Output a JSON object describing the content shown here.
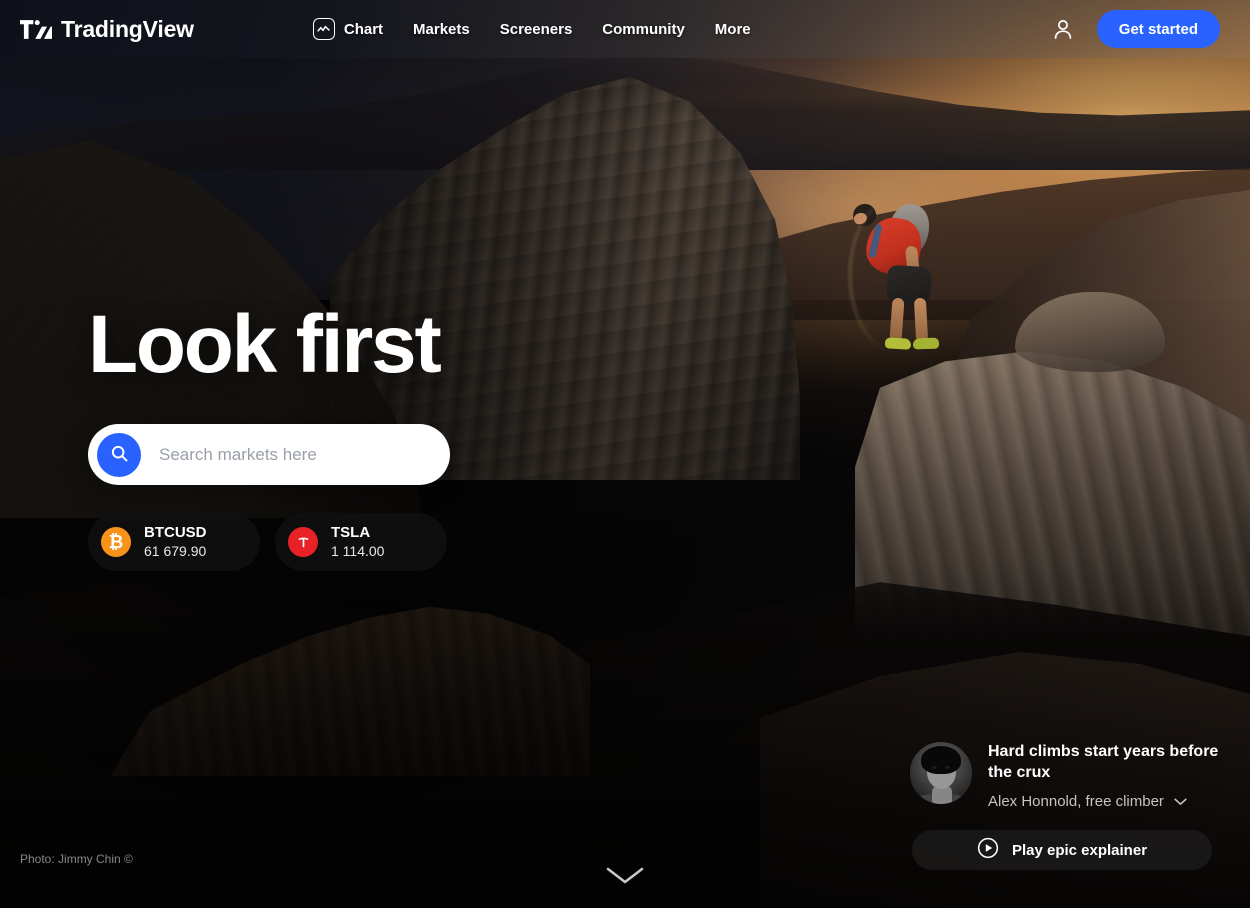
{
  "header": {
    "brand": "TradingView",
    "brand_logo_icon": "tradingview-logo-icon",
    "nav": [
      {
        "label": "Chart",
        "icon": "chart-icon"
      },
      {
        "label": "Markets",
        "icon": ""
      },
      {
        "label": "Screeners",
        "icon": ""
      },
      {
        "label": "Community",
        "icon": ""
      },
      {
        "label": "More",
        "icon": ""
      }
    ],
    "user_icon": "user-icon",
    "cta_label": "Get started",
    "cta_color": "#2962ff"
  },
  "hero": {
    "headline": "Look first",
    "search": {
      "placeholder": "Search markets here",
      "icon": "search-icon",
      "icon_bg": "#2962ff"
    },
    "tickers": [
      {
        "symbol": "BTCUSD",
        "price": "61 679.90",
        "icon": "bitcoin-icon",
        "icon_bg": "#f7931a",
        "glyph": "₿"
      },
      {
        "symbol": "TSLA",
        "price": "1 114.00",
        "icon": "tesla-icon",
        "icon_bg": "#e82127",
        "glyph": "T"
      }
    ],
    "photo_credit": "Photo: Jimmy Chin ©",
    "scroll_cue_icon": "chevron-down-icon"
  },
  "quote_card": {
    "avatar_icon": "avatar",
    "text": "Hard climbs start years before the crux",
    "attribution": "Alex Honnold, free climber",
    "attribution_chevron_icon": "chevron-down-icon",
    "play_button_label": "Play epic explainer",
    "play_button_icon": "play-circle-icon"
  }
}
